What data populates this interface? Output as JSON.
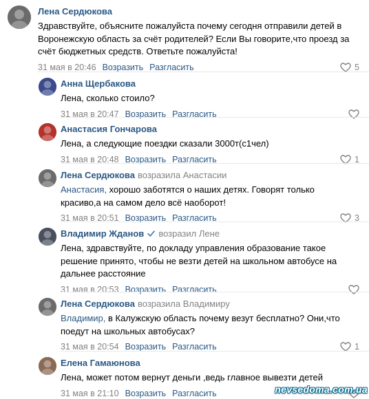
{
  "actions": {
    "reply": "Возразить",
    "dislike": "Разгласить"
  },
  "comments": [
    {
      "author": "Лена Сердюкова",
      "verb": "",
      "target": "",
      "addressee": "",
      "lines": [
        "Здравствуйте, объясните пожалуйста почему сегодня отправили детей в",
        "Воронежскую область за счёт родителей? Если Вы говорите,что проезд за",
        "счёт бюджетных средств. Ответьте пожалуйста!"
      ],
      "date": "31 мая в 20:46",
      "likes": "5",
      "avatar_color": "#6b6b6b"
    },
    {
      "author": "Анна Щербакова",
      "verb": "",
      "target": "",
      "addressee": "",
      "lines": [
        "Лена, сколько стоило?"
      ],
      "date": "31 мая в 20:47",
      "likes": "",
      "avatar_color": "#3a4a8c"
    },
    {
      "author": "Анастасия Гончарова",
      "verb": "",
      "target": "",
      "addressee": "",
      "lines": [
        "Лена, а следующие поездки сказали 3000т(с1чел)"
      ],
      "date": "31 мая в 20:48",
      "likes": "1",
      "avatar_color": "#b5322c"
    },
    {
      "author": "Лена Сердюкова",
      "verb": "возразила",
      "target": "Анастасии",
      "addressee": "Анастасия,",
      "lines": [
        "хорошо заботятся о наших детях. Говорят только",
        "красиво,а на самом дело всё наоборот!"
      ],
      "date": "31 мая в 20:51",
      "likes": "3",
      "avatar_color": "#6b6b6b"
    },
    {
      "author": "Владимир Жданов",
      "verb": "возразил",
      "target": "Лене",
      "addressee": "",
      "lines": [
        "Лена, здравствуйте, по докладу управления образование такое",
        "решение принято, чтобы не везти детей на школьном автобусе на",
        "дальнее расстояние"
      ],
      "date": "31 мая в 20:53",
      "likes": "",
      "avatar_color": "#4a4f5e"
    },
    {
      "author": "Лена Сердюкова",
      "verb": "возразила",
      "target": "Владимиру",
      "addressee": "Владимир,",
      "lines": [
        "в Калужскую область почему везут бесплатно? Они,что",
        "поедут на школьных автобусах?"
      ],
      "date": "31 мая в 20:54",
      "likes": "1",
      "avatar_color": "#6b6b6b"
    },
    {
      "author": "Елена Гамаюнова",
      "verb": "",
      "target": "",
      "addressee": "",
      "lines": [
        "Лена, может потом вернут деньги ,ведь главное вывезти детей"
      ],
      "date": "31 мая в 21:10",
      "likes": "",
      "avatar_color": "#8a6a55"
    }
  ],
  "watermark": "nevsedoma.com.ua",
  "colors": {
    "link": "#2a5885",
    "meta": "#828282",
    "separator": "#e7e8ec"
  }
}
